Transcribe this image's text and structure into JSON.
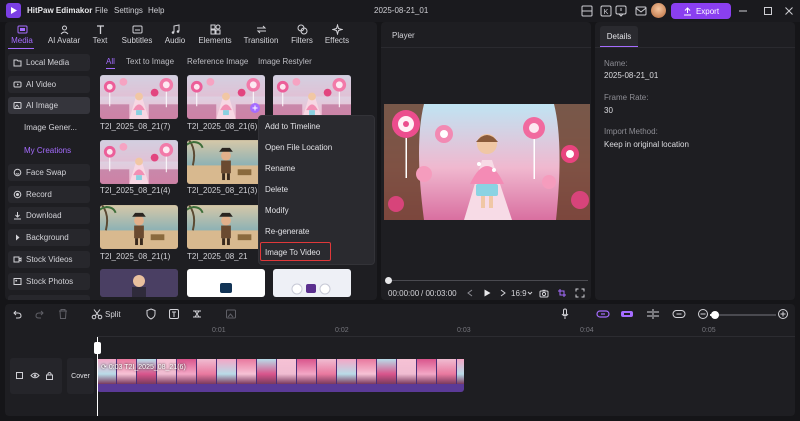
{
  "app": {
    "title": "HitPaw Edimakor",
    "menu": [
      "File",
      "Settings",
      "Help"
    ],
    "project_title": "2025-08-21_01",
    "export_label": "Export"
  },
  "toolbar": {
    "tabs": [
      {
        "label": "Media",
        "icon": "media-icon",
        "active": true
      },
      {
        "label": "AI Avatar",
        "icon": "avatar-icon",
        "active": false
      },
      {
        "label": "Text",
        "icon": "text-icon",
        "active": false
      },
      {
        "label": "Subtitles",
        "icon": "subtitles-icon",
        "active": false
      },
      {
        "label": "Audio",
        "icon": "music-icon",
        "active": false
      },
      {
        "label": "Elements",
        "icon": "elements-icon",
        "active": false
      },
      {
        "label": "Transition",
        "icon": "transition-icon",
        "active": false
      },
      {
        "label": "Filters",
        "icon": "filters-icon",
        "active": false
      },
      {
        "label": "Effects",
        "icon": "effects-icon",
        "active": false
      }
    ]
  },
  "sidebar": {
    "items": [
      {
        "label": "Local Media",
        "icon": "folder-icon"
      },
      {
        "label": "AI Video",
        "icon": "ai-video-icon"
      },
      {
        "label": "AI Image",
        "icon": "ai-image-icon",
        "active": true
      },
      {
        "label": "Image Gener...",
        "sub": true
      },
      {
        "label": "My Creations",
        "sub": true,
        "active": true
      },
      {
        "label": "Face Swap",
        "icon": "face-swap-icon"
      },
      {
        "label": "Record",
        "icon": "record-icon"
      },
      {
        "label": "Download",
        "icon": "download-icon"
      },
      {
        "label": "Background",
        "icon": "background-icon"
      },
      {
        "label": "Stock Videos",
        "icon": "stock-video-icon"
      },
      {
        "label": "Stock Photos",
        "icon": "stock-photo-icon"
      }
    ]
  },
  "media": {
    "tabs": [
      "All",
      "Text to Image",
      "Reference Image",
      "Image Restyler"
    ],
    "thumbnails": [
      {
        "label": "T2I_2025_08_21(7)",
        "theme": "candy"
      },
      {
        "label": "T2I_2025_08_21(6)",
        "theme": "candy"
      },
      {
        "label": "",
        "theme": "candy"
      },
      {
        "label": "T2I_2025_08_21(4)",
        "theme": "candy"
      },
      {
        "label": "T2I_2025_08_21(3)",
        "theme": "pirate"
      },
      {
        "label": "T2I_2025_08_21(1)",
        "theme": "pirate"
      },
      {
        "label": "T2I_2025_08_21",
        "theme": "pirate"
      }
    ]
  },
  "context_menu": {
    "items": [
      "Add to Timeline",
      "Open File Location",
      "Rename",
      "Delete",
      "Modify",
      "Re-generate",
      "Image To Video"
    ]
  },
  "player": {
    "title": "Player",
    "current_time": "00:00:00",
    "total_time": "/ 00:03:00",
    "aspect": "16:9"
  },
  "details": {
    "tab": "Details",
    "name_label": "Name:",
    "name_value": "2025-08-21_01",
    "frame_rate_label": "Frame Rate:",
    "frame_rate_value": "30",
    "import_label": "Import Method:",
    "import_value": "Keep in original location"
  },
  "timeline": {
    "split_label": "Split",
    "ruler": [
      "0:01",
      "0:02",
      "0:03",
      "0:04",
      "0:05"
    ],
    "cover_label": "Cover",
    "clip": {
      "duration": "0:03",
      "name": "T2I_2025_08_21(6)"
    },
    "zoom_level": 0.08
  },
  "colors": {
    "accent": "#a56cff",
    "export": "#8a3ff0",
    "highlight_box": "#e0383a",
    "clip": "#5b3a97"
  }
}
